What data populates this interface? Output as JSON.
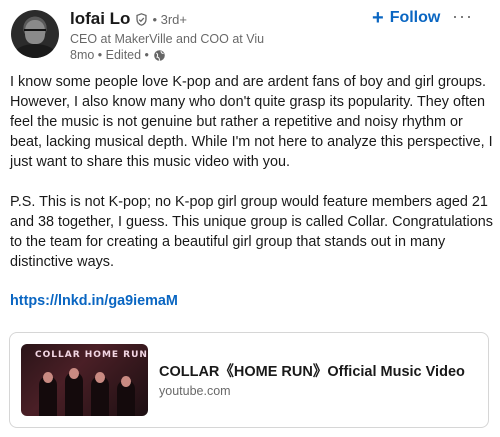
{
  "author": {
    "name": "lofai Lo",
    "degree": "• 3rd+",
    "headline": "CEO at MakerVille and COO at Viu",
    "meta": "8mo • Edited •"
  },
  "actions": {
    "follow_plus": "+",
    "follow_label": "Follow",
    "more_label": "···"
  },
  "post": {
    "paragraphs": [
      "I know some people love K-pop and are ardent fans of boy and girl groups. However, I also know many who don't quite grasp its popularity. They often feel the music is not genuine but rather a repetitive and noisy rhythm or beat, lacking musical depth. While I'm not here to analyze this perspective, I just want to share this music video with you.",
      "P.S. This is not K-pop; no K-pop girl group would feature members aged 21 and 38 together, I guess. This unique group is called Collar. Congratulations to the team for creating a beautiful girl group that stands out in many distinctive ways."
    ],
    "link": "https://lnkd.in/ga9iemaM"
  },
  "link_card": {
    "title": "COLLAR《HOME RUN》Official Music Video",
    "source": "youtube.com",
    "thumbnail_text": "COLLAR HOME RUN"
  },
  "colors": {
    "accent": "#0a66c2",
    "text": "#000000e6",
    "muted": "#00000099"
  }
}
